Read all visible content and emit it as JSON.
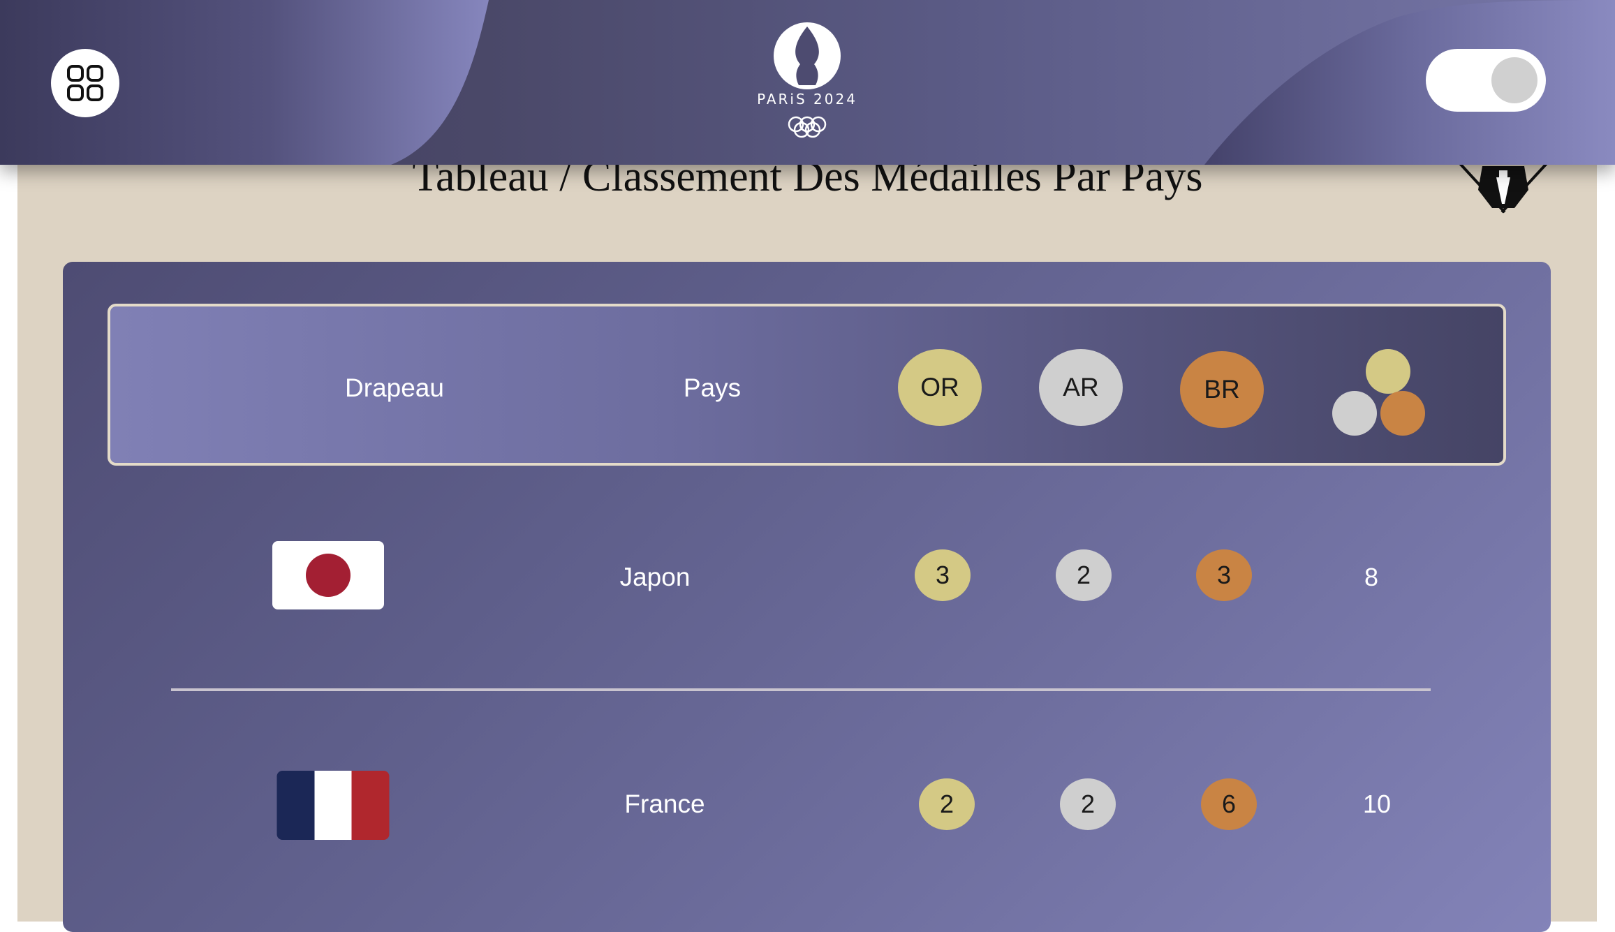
{
  "page": {
    "title": "Tableau / Classement Des Médailles Par Pays"
  },
  "header": {
    "logo_text": "PARiS 2024",
    "menu_icon": "grid-icon",
    "toggle_state": "off"
  },
  "colors": {
    "gold": "#d4c985",
    "silver": "#cfcfcf",
    "bronze": "#c98444",
    "panel": "#6e6e9e",
    "page_bg": "#ddd3c3"
  },
  "table": {
    "headers": {
      "flag": "Drapeau",
      "country": "Pays",
      "gold": "OR",
      "silver": "AR",
      "bronze": "BR",
      "total_icon": "medals-total-icon"
    },
    "rows": [
      {
        "country": "Japon",
        "flag": "japan-flag",
        "gold": "3",
        "silver": "2",
        "bronze": "3",
        "total": "8"
      },
      {
        "country": "France",
        "flag": "france-flag",
        "gold": "2",
        "silver": "2",
        "bronze": "6",
        "total": "10"
      }
    ]
  }
}
